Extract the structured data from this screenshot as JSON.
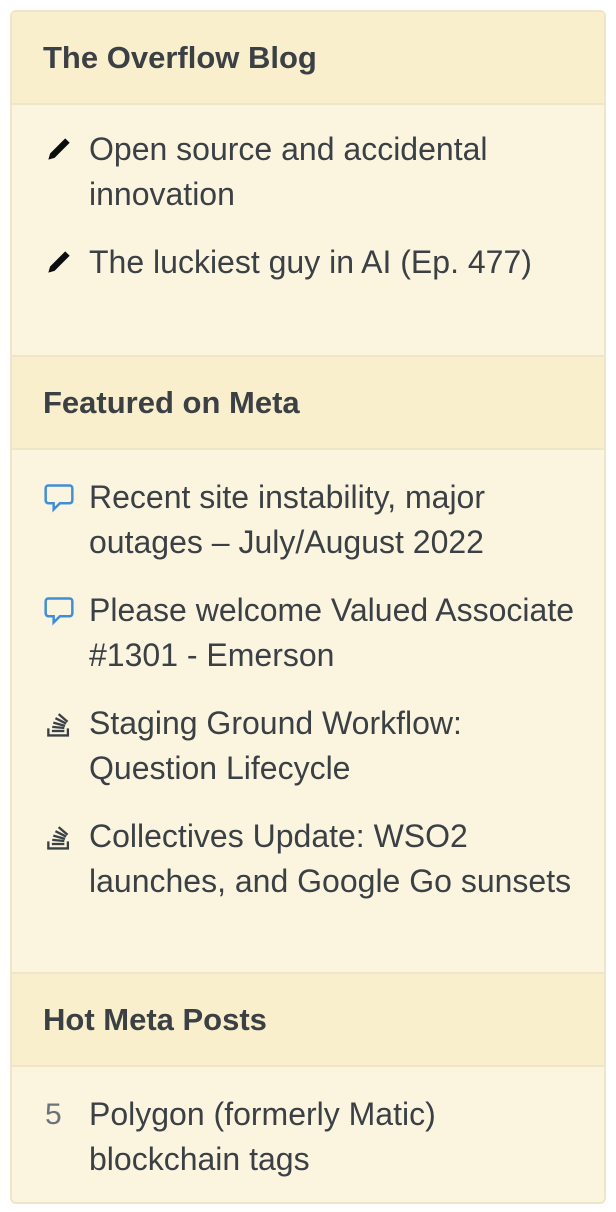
{
  "blog": {
    "title": "The Overflow Blog",
    "items": [
      {
        "icon": "pencil-icon",
        "text": "Open source and accidental innovation"
      },
      {
        "icon": "pencil-icon",
        "text": "The luckiest guy in AI (Ep. 477)"
      }
    ]
  },
  "meta": {
    "title": "Featured on Meta",
    "items": [
      {
        "icon": "chat-bubble-icon",
        "text": "Recent site instability, major outages – July/August 2022"
      },
      {
        "icon": "chat-bubble-icon",
        "text": "Please welcome Valued Associate #1301 - Emerson"
      },
      {
        "icon": "stack-overflow-logo-icon",
        "text": "Staging Ground Workflow: Question Lifecycle"
      },
      {
        "icon": "stack-overflow-logo-icon",
        "text": "Collectives Update: WSO2 launches, and Google Go sunsets"
      }
    ]
  },
  "hot": {
    "title": "Hot Meta Posts",
    "items": [
      {
        "count": "5",
        "text": "Polygon (formerly Matic) blockchain tags"
      }
    ]
  },
  "colors": {
    "background": "#fbf4df",
    "header_background": "#faefcd",
    "border": "#efe5c8",
    "text": "#3b4045",
    "chat_icon": "#3f8fd8"
  }
}
